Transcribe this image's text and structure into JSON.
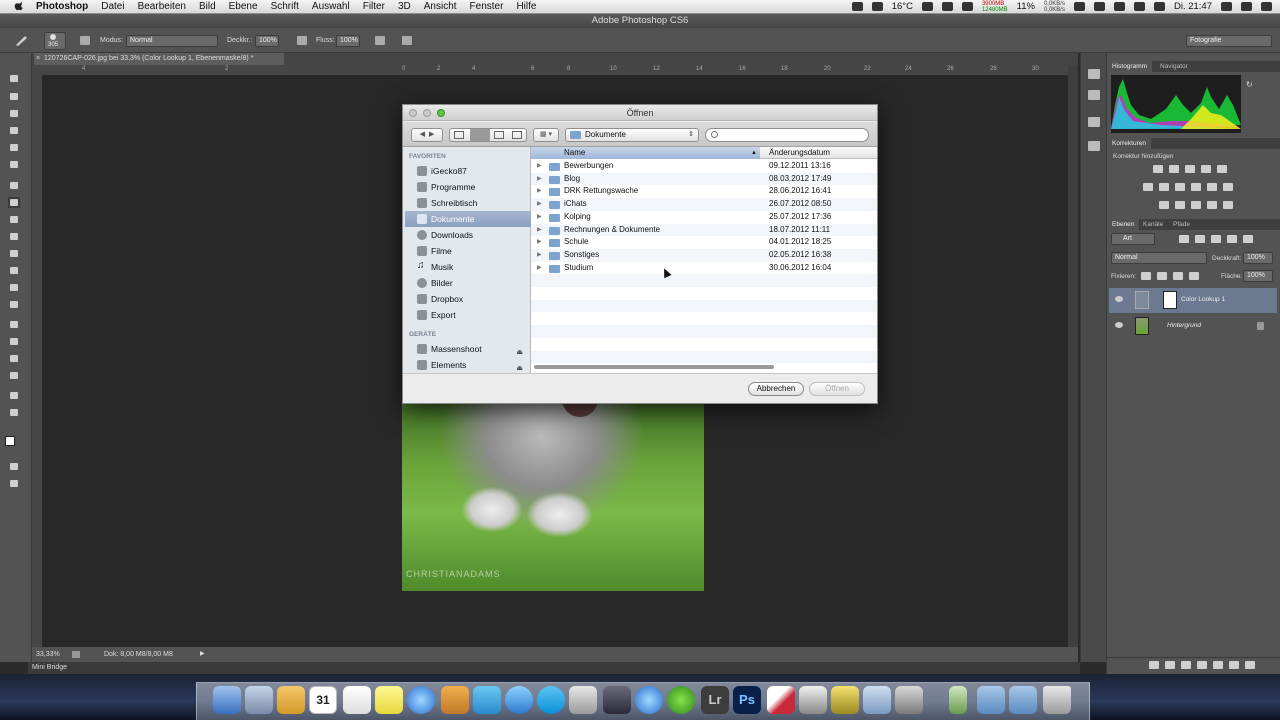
{
  "menubar": {
    "app": "Photoshop",
    "items": [
      "Datei",
      "Bearbeiten",
      "Bild",
      "Ebene",
      "Schrift",
      "Auswahl",
      "Filter",
      "3D",
      "Ansicht",
      "Fenster",
      "Hilfe"
    ],
    "temperature": "16°C",
    "net_tx": "0,0KB/s",
    "net_rx": "0,0KB/s",
    "mem_line1": "3900MB",
    "mem_line2": "12480MB",
    "cpu": "11%",
    "clock": "Di. 21:47"
  },
  "ps_title": "Adobe Photoshop CS6",
  "options": {
    "brush_size": "305",
    "modus_label": "Modus:",
    "modus_value": "Normal",
    "deckkr_label": "Deckkr.:",
    "deckkr_value": "100%",
    "fluss_label": "Fluss:",
    "fluss_value": "100%",
    "workspace": "Fotografie"
  },
  "document_tab": "120726CAP-026.jpg bei 33,3% (Color Lookup 1, Ebenenmaske/8) *",
  "ruler_ticks": [
    "4",
    "2",
    "0",
    "2",
    "4",
    "6",
    "8",
    "10",
    "12",
    "14",
    "16",
    "18",
    "20",
    "22",
    "24",
    "26",
    "28",
    "30"
  ],
  "status": {
    "zoom": "33,33%",
    "doc": "Dok: 8,00 M8/8,00 M8"
  },
  "mini_bridge": "Mini Bridge",
  "photo_watermark": "CHRISTIANADAMS",
  "panels": {
    "histo_tabs": [
      "Histogramm",
      "Navigator"
    ],
    "korrekturen_tab": "Korrekturen",
    "korrektur_add": "Korrektur hinzufügen",
    "layer_tabs": [
      "Ebenen",
      "Kanäle",
      "Pfade"
    ],
    "filter_kind": "Art",
    "blend_mode": "Normal",
    "deckkraft_label": "Deckkraft:",
    "deckkraft_value": "100%",
    "fixieren_label": "Fixieren:",
    "flaeche_label": "Fläche:",
    "flaeche_value": "100%",
    "layers": [
      {
        "name": "Color Lookup 1"
      },
      {
        "name": "Hintergrund"
      }
    ]
  },
  "dialog": {
    "title": "Öffnen",
    "location": "Dokumente",
    "search_placeholder": "",
    "favorites_header": "FAVORITEN",
    "favorites": [
      "iGecko87",
      "Programme",
      "Schreibtisch",
      "Dokumente",
      "Downloads",
      "Filme",
      "Musik",
      "Bilder",
      "Dropbox",
      "Export"
    ],
    "devices_header": "GERÄTE",
    "devices": [
      "Massenshoot",
      "Elements"
    ],
    "col_name": "Name",
    "col_date": "Änderungsdatum",
    "files": [
      {
        "name": "Bewerbungen",
        "date": "09.12.2011 13:16"
      },
      {
        "name": "Blog",
        "date": "08.03.2012 17:49"
      },
      {
        "name": "DRK Rettungswache",
        "date": "28.06.2012 16:41"
      },
      {
        "name": "iChats",
        "date": "26.07.2012 08:50"
      },
      {
        "name": "Kolping",
        "date": "25.07.2012 17:36"
      },
      {
        "name": "Rechnungen & Dokumente",
        "date": "18.07.2012 11:11"
      },
      {
        "name": "Schule",
        "date": "04.01.2012 18:25"
      },
      {
        "name": "Sonstiges",
        "date": "02.05.2012 16:38"
      },
      {
        "name": "Studium",
        "date": "30.06.2012 16:04"
      }
    ],
    "cancel": "Abbrechen",
    "open": "Öffnen"
  },
  "dock": {
    "calendar_day": "31",
    "lightroom": "Lr",
    "photoshop": "Ps"
  }
}
